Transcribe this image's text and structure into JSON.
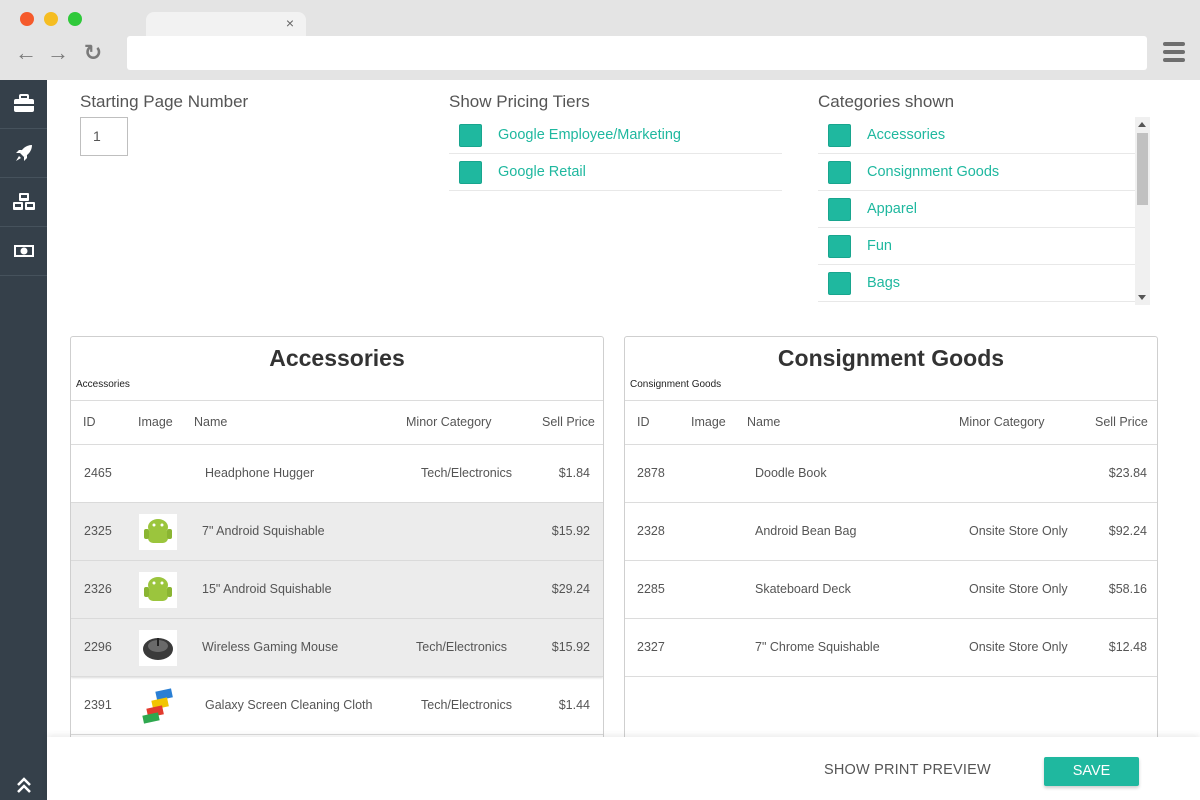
{
  "browser": {
    "tab_close": "×",
    "back_icon": "←",
    "forward_icon": "→",
    "reload_icon": "↻"
  },
  "sidebar": {
    "items": [
      {
        "icon": "briefcase-icon"
      },
      {
        "icon": "rocket-icon"
      },
      {
        "icon": "cubes-icon"
      },
      {
        "icon": "money-icon"
      }
    ],
    "bottom_icon": "double-chevron-up-icon"
  },
  "filters": {
    "page_number": {
      "label": "Starting Page Number",
      "value": "1"
    },
    "pricing_tiers": {
      "label": "Show Pricing Tiers",
      "items": [
        "Google Employee/Marketing",
        "Google Retail"
      ]
    },
    "categories": {
      "label": "Categories shown",
      "items": [
        "Accessories",
        "Consignment Goods",
        "Apparel",
        "Fun",
        "Bags"
      ]
    }
  },
  "columns": {
    "id": "ID",
    "image": "Image",
    "name": "Name",
    "minor": "Minor Category",
    "price": "Sell Price"
  },
  "panels": {
    "left": {
      "title": "Accessories",
      "subtitle": "Accessories",
      "rows": [
        {
          "id": "2465",
          "name": "Headphone Hugger",
          "minor": "Tech/Electronics",
          "price": "$1.84",
          "image": "",
          "shaded": false
        },
        {
          "id": "2325",
          "name": "7\" Android Squishable",
          "minor": "",
          "price": "$15.92",
          "image": "android-squishable-image",
          "shaded": true
        },
        {
          "id": "2326",
          "name": "15\" Android Squishable",
          "minor": "",
          "price": "$29.24",
          "image": "android-squishable-image",
          "shaded": true
        },
        {
          "id": "2296",
          "name": "Wireless Gaming Mouse",
          "minor": "Tech/Electronics",
          "price": "$15.92",
          "image": "gaming-mouse-image",
          "shaded": true
        },
        {
          "id": "2391",
          "name": "Galaxy Screen Cleaning Cloth",
          "minor": "Tech/Electronics",
          "price": "$1.44",
          "image": "cleaning-cloth-image",
          "shaded": false
        }
      ]
    },
    "right": {
      "title": "Consignment Goods",
      "subtitle": "Consignment Goods",
      "rows": [
        {
          "id": "2878",
          "name": "Doodle Book",
          "minor": "",
          "price": "$23.84"
        },
        {
          "id": "2328",
          "name": "Android Bean Bag",
          "minor": "Onsite Store Only",
          "price": "$92.24"
        },
        {
          "id": "2285",
          "name": "Skateboard Deck",
          "minor": "Onsite Store Only",
          "price": "$58.16"
        },
        {
          "id": "2327",
          "name": "7\" Chrome Squishable",
          "minor": "Onsite Store Only",
          "price": "$12.48"
        }
      ]
    }
  },
  "footer": {
    "preview_label": "SHOW PRINT PREVIEW",
    "save_label": "SAVE"
  },
  "colors": {
    "accent": "#1fb89f",
    "sidebar": "#35404a"
  }
}
